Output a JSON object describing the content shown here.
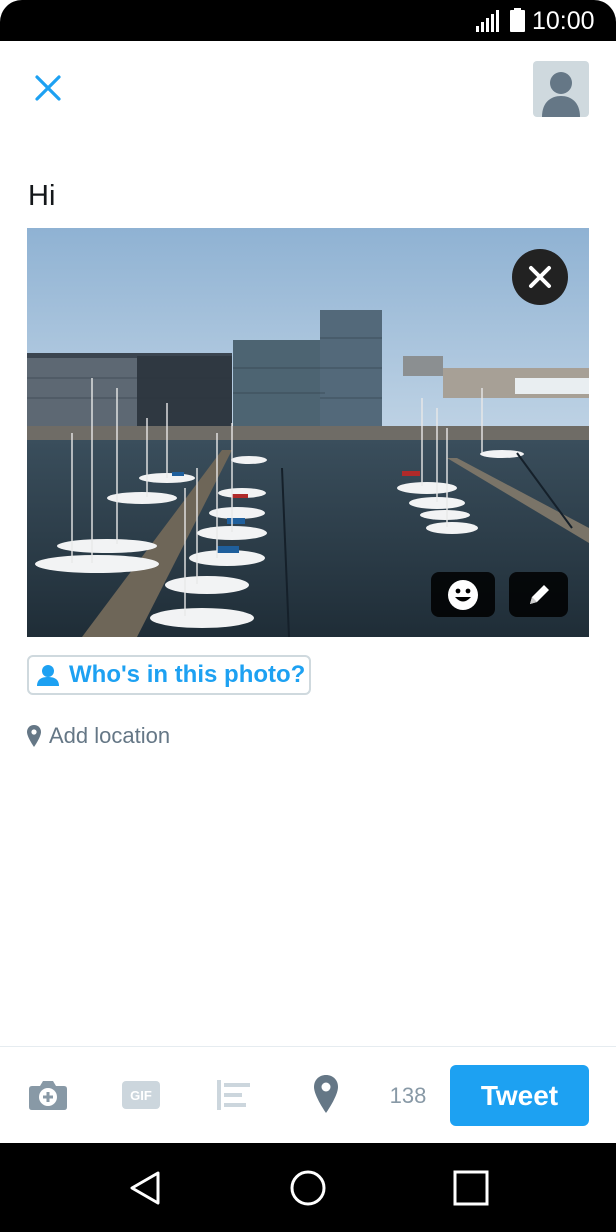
{
  "status_bar": {
    "time": "10:00",
    "icons": [
      "signal-icon",
      "battery-icon"
    ]
  },
  "header": {
    "close_icon": "close-icon",
    "avatar_icon": "default-avatar-icon"
  },
  "composer": {
    "text": "Hi"
  },
  "photo": {
    "icons": [
      "remove-photo-icon",
      "sticker-icon",
      "edit-photo-icon"
    ]
  },
  "tag_people": {
    "label": "Who's in this photo?",
    "icon": "person-icon"
  },
  "location": {
    "label": "Add location",
    "icon": "map-pin-icon"
  },
  "toolbar": {
    "icons": [
      "camera-icon",
      "gif-icon",
      "poll-icon",
      "location-icon"
    ],
    "char_counter": "138",
    "tweet_label": "Tweet"
  },
  "nav_bar": {
    "icons": [
      "back-icon",
      "home-icon",
      "recents-icon"
    ]
  },
  "colors": {
    "accent": "#1da1f2",
    "muted": "#657786",
    "text": "#14171a"
  }
}
